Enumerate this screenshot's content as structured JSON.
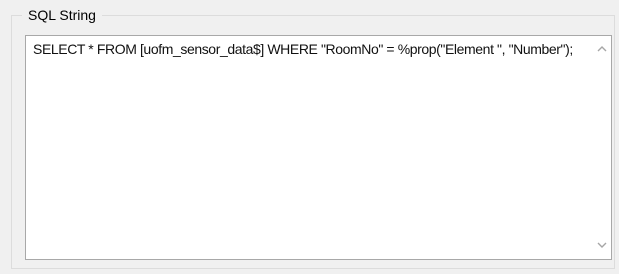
{
  "group": {
    "title": "SQL String"
  },
  "editor": {
    "sql_text": "SELECT * FROM [uofm_sensor_data$] WHERE \"RoomNo\" = %prop(\"Element \", \"Number\");"
  },
  "icons": {
    "scroll_up": "chevron-up-icon",
    "scroll_down": "chevron-down-icon"
  },
  "colors": {
    "background": "#f0f0f0",
    "editor_background": "#ffffff",
    "border": "#a8a8a8",
    "scroll_arrow": "#a6a6a6"
  }
}
